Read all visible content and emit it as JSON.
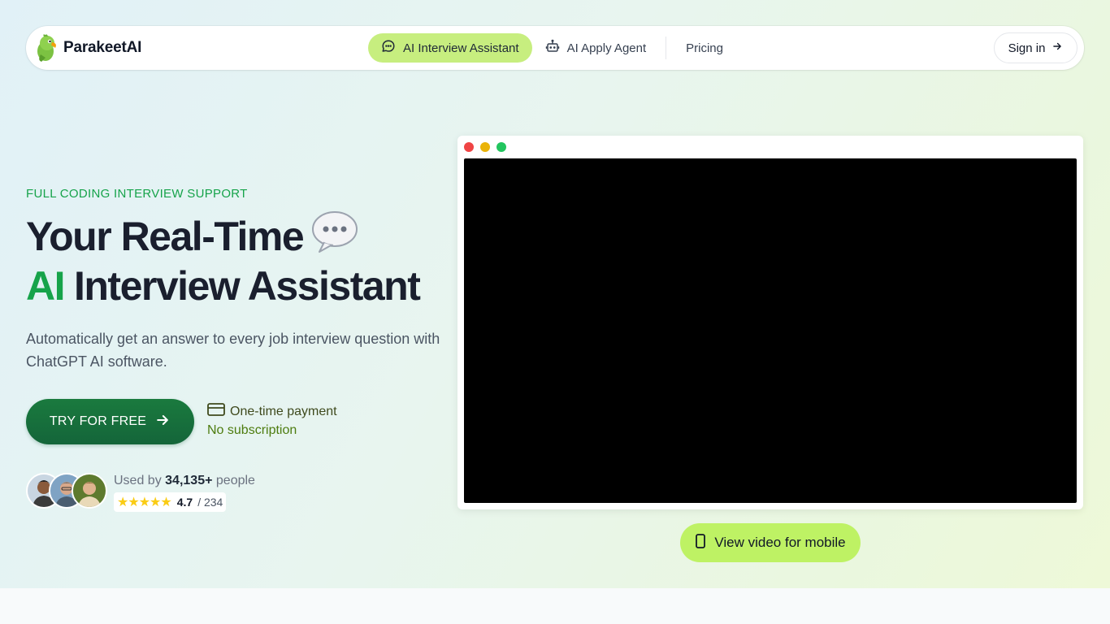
{
  "nav": {
    "brand": "ParakeetAI",
    "items": [
      {
        "label": "AI Interview Assistant",
        "icon": "chat-bubble-icon",
        "active": true
      },
      {
        "label": "AI Apply Agent",
        "icon": "robot-icon",
        "active": false
      },
      {
        "label": "Pricing",
        "active": false
      }
    ],
    "signin_label": "Sign in"
  },
  "hero": {
    "eyebrow": "FULL CODING INTERVIEW SUPPORT",
    "headline_line1": "Your Real-Time",
    "headline_emoji": "speech-balloon-emoji",
    "headline_accent": "AI",
    "headline_line2": "Interview Assistant",
    "subtitle": "Automatically get an answer to every job interview question with ChatGPT AI software.",
    "cta_label": "TRY FOR FREE",
    "payment_label": "One-time payment",
    "payment_sub": "No subscription",
    "used_by_prefix": "Used by",
    "used_by_count": "34,135+",
    "used_by_suffix": "people",
    "rating_score": "4.7",
    "rating_count": "/ 234",
    "stars": 5
  },
  "video": {
    "mobile_button_label": "View video for mobile"
  },
  "colors": {
    "accent_green": "#16a34a",
    "active_nav": "#c7ee7f",
    "cta_green": "#14653a",
    "mobile_button": "#bef264"
  }
}
